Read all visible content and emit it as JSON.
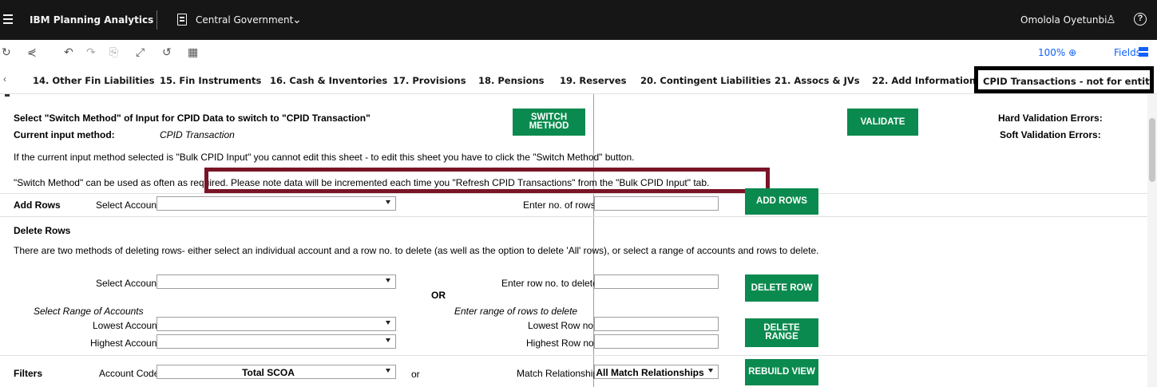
{
  "header": {
    "brand": "IBM Planning Analytics",
    "workspace": "Central Government",
    "user": "Omolola Oyetunbi"
  },
  "toolbar": {
    "zoom": "100%",
    "fields": "Fields"
  },
  "tabs": [
    {
      "label": "14. Other Fin Liabilities"
    },
    {
      "label": "15. Fin Instruments"
    },
    {
      "label": "16. Cash & Inventories"
    },
    {
      "label": "17. Provisions"
    },
    {
      "label": "18. Pensions"
    },
    {
      "label": "19. Reserves"
    },
    {
      "label": "20. Contingent Liabilities"
    },
    {
      "label": "21. Assocs & JVs"
    },
    {
      "label": "22. Add Information"
    },
    {
      "label": "CPID Transactions - not for entity use",
      "active": true
    }
  ],
  "sheet": {
    "switch_instruction": "Select \"Switch Method\" of Input for CPID Data to switch to \"CPID Transaction\"",
    "current_method_label": "Current input method:",
    "current_method_value": "CPID Transaction",
    "switch_button": "SWITCH METHOD",
    "validate_button": "VALIDATE",
    "hard_errors_label": "Hard Validation Errors:",
    "soft_errors_label": "Soft Validation Errors:",
    "bulk_note": "If the current input method selected is \"Bulk CPID Input\" you cannot edit this sheet - to edit this sheet you have to click the \"Switch Method\" button.",
    "switch_note_a": "\"Switch Method\" can be used as often as required. ",
    "switch_note_b": "Please note data will be incremented each time you \"Refresh CPID Transactions\" from the \"Bulk CPID Input\" tab.",
    "add_rows": {
      "title": "Add Rows",
      "select_account": "Select Account",
      "enter_rows": "Enter no. of rows",
      "button": "ADD ROWS"
    },
    "delete_rows": {
      "title": "Delete Rows",
      "description": "There are two methods of deleting rows- either select an individual account and a row no. to delete (as well as the option to delete 'All' rows), or select a range of accounts and rows to delete.",
      "select_account": "Select Account",
      "enter_row": "Enter row no. to delete",
      "delete_row_button": "DELETE ROW",
      "or": "OR",
      "range_accounts": "Select Range of Accounts",
      "range_rows": "Enter range of rows to delete",
      "lowest_account": "Lowest Account",
      "highest_account": "Highest Account",
      "lowest_row": "Lowest Row no.",
      "highest_row": "Highest Row no.",
      "delete_range_button": "DELETE RANGE"
    },
    "filters": {
      "title": "Filters",
      "account_code": "Account Code",
      "account_code_value": "Total SCOA",
      "or": "or",
      "match_relationship": "Match Relationship",
      "match_value": "All Match Relationships",
      "rebuild_button": "REBUILD VIEW"
    }
  },
  "colors": {
    "button_green": "#0a8a4e",
    "highlight_border": "#7a1426",
    "link_blue": "#0f62fe",
    "topbar": "#161616"
  },
  "icons": [
    "menu-icon",
    "workspace-icon",
    "chevron-down-icon",
    "user-icon",
    "help-icon",
    "refresh-icon",
    "share-icon",
    "undo-icon",
    "redo-icon",
    "snapshot-icon",
    "expand-icon",
    "reset-icon",
    "grid-icon",
    "zoom-icon",
    "fields-icon"
  ]
}
